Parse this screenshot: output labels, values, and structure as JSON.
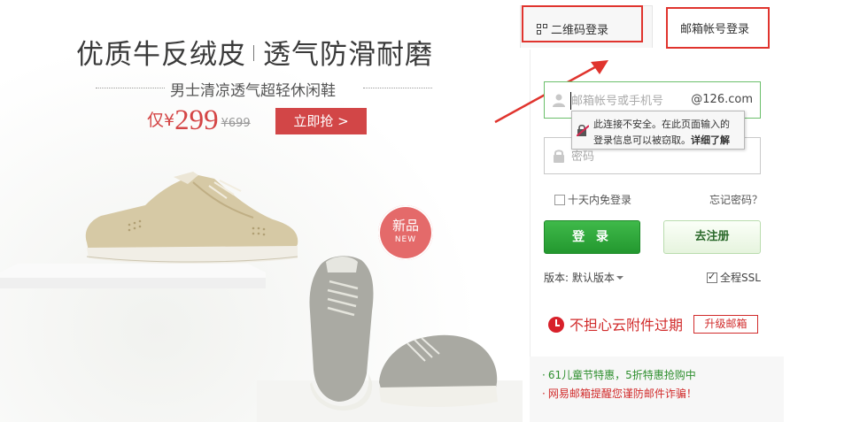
{
  "banner": {
    "headline_left": "优质牛反绒皮",
    "headline_right": "透气防滑耐磨",
    "subline": "男士清凉透气超轻休闲鞋",
    "price_prefix": "仅",
    "currency": "¥",
    "price": "299",
    "old_price": "¥699",
    "buy_button": "立即抢 >",
    "badge_cn": "新品",
    "badge_en": "NEW"
  },
  "tabs": {
    "qr_login": "二维码登录",
    "mail_login": "邮箱帐号登录"
  },
  "form": {
    "username_placeholder": "邮箱帐号或手机号",
    "domain_suffix": "@126.com",
    "password_placeholder": "密码",
    "security_tip_line1": "此连接不安全。在此页面输入的",
    "security_tip_line2": "登录信息可以被窃取。",
    "security_tip_link": "详细了解",
    "remember_label": "十天内免登录",
    "forgot_password": "忘记密码？",
    "login_button": "登 录",
    "register_button": "去注册",
    "version_label": "版本: 默认版本",
    "ssl_label": "全程SSL"
  },
  "promo": {
    "text": "不担心云附件过期",
    "upgrade_button": "升级邮箱"
  },
  "news": [
    "61儿童节特惠，5折特惠抢购中",
    "网易邮箱提醒您谨防邮件诈骗！"
  ],
  "colors": {
    "accent_red": "#d24647",
    "login_green": "#2aa535",
    "annotation_red": "#e0342e"
  }
}
